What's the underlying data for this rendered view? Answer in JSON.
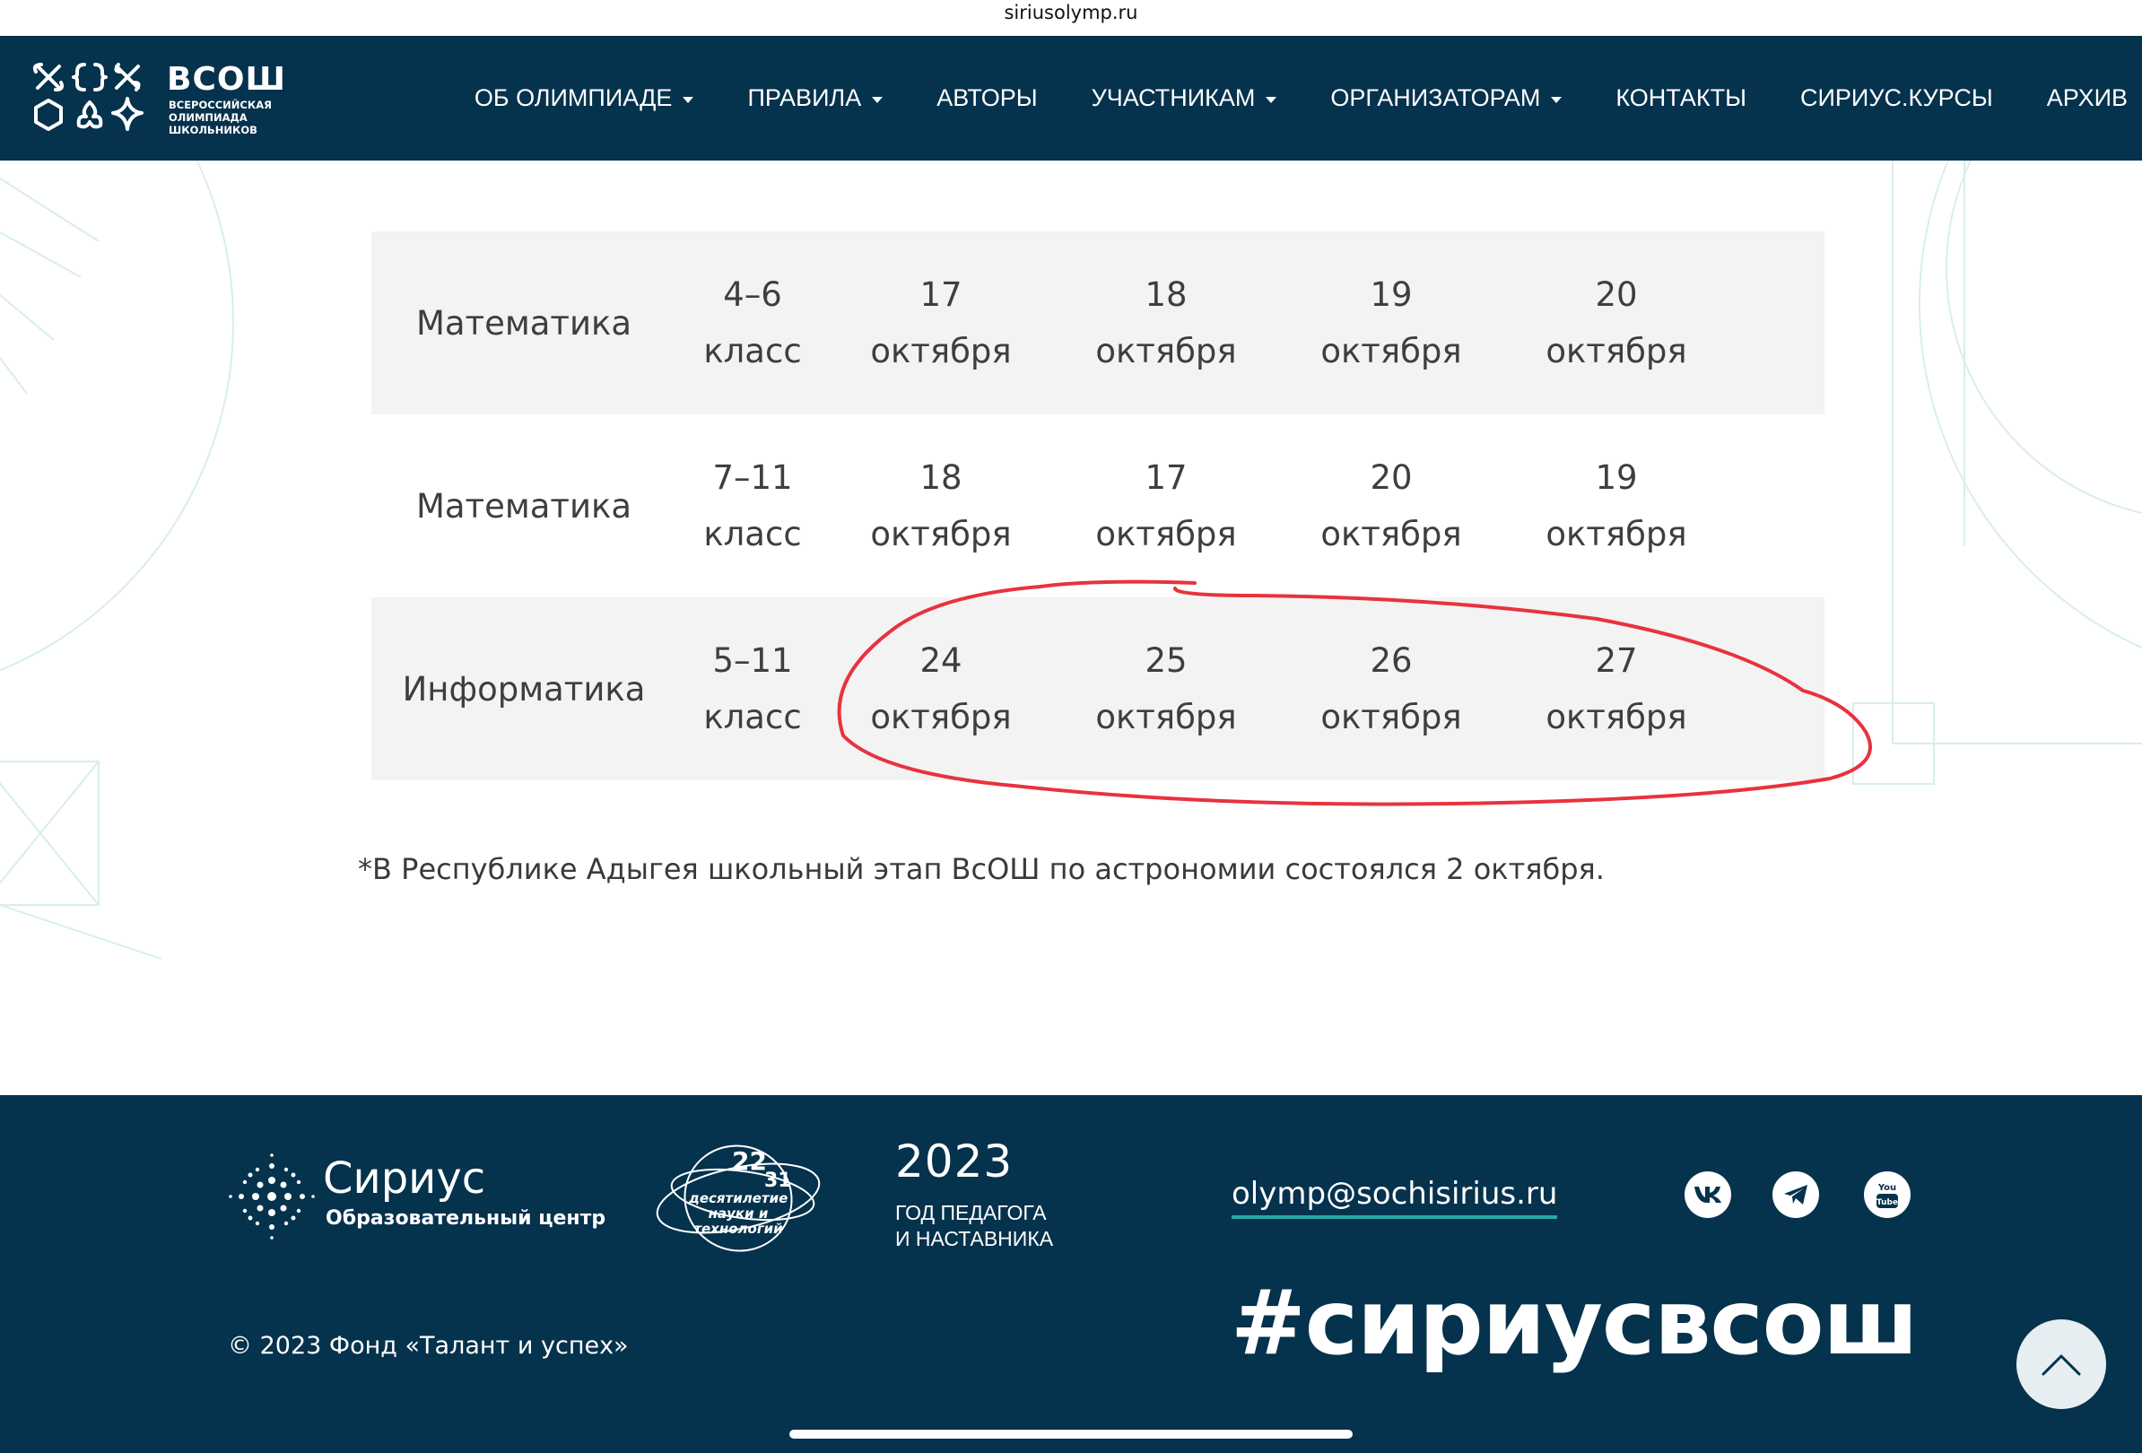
{
  "browser": {
    "url": "siriusolymp.ru"
  },
  "header": {
    "logo": {
      "title": "ВСОШ",
      "subtitle_lines": [
        "ВСЕРОССИЙСКАЯ",
        "ОЛИМПИАДА",
        "ШКОЛЬНИКОВ"
      ]
    },
    "nav": [
      {
        "label": "ОБ ОЛИМПИАДЕ",
        "dropdown": true
      },
      {
        "label": "ПРАВИЛА",
        "dropdown": true
      },
      {
        "label": "АВТОРЫ",
        "dropdown": false
      },
      {
        "label": "УЧАСТНИКАМ",
        "dropdown": true
      },
      {
        "label": "ОРГАНИЗАТОРАМ",
        "dropdown": true
      },
      {
        "label": "КОНТАКТЫ",
        "dropdown": false
      },
      {
        "label": "СИРИУС.КУРСЫ",
        "dropdown": false
      },
      {
        "label": "АРХИВ",
        "dropdown": false
      }
    ]
  },
  "table": {
    "partial_row": {
      "grade": "класс",
      "d1": "октября",
      "d2": "октября",
      "d3": "октября",
      "d4": "октября"
    },
    "rows": [
      {
        "subject": "Математика",
        "grade": [
          "4–6",
          "класс"
        ],
        "d1": [
          "17",
          "октября"
        ],
        "d2": [
          "18",
          "октября"
        ],
        "d3": [
          "19",
          "октября"
        ],
        "d4": [
          "20",
          "октября"
        ],
        "shaded": true
      },
      {
        "subject": "Математика",
        "grade": [
          "7–11",
          "класс"
        ],
        "d1": [
          "18",
          "октября"
        ],
        "d2": [
          "17",
          "октября"
        ],
        "d3": [
          "20",
          "октября"
        ],
        "d4": [
          "19",
          "октября"
        ],
        "shaded": false
      },
      {
        "subject": "Информатика",
        "grade": [
          "5–11",
          "класс"
        ],
        "d1": [
          "24",
          "октября"
        ],
        "d2": [
          "25",
          "октября"
        ],
        "d3": [
          "26",
          "октября"
        ],
        "d4": [
          "27",
          "октября"
        ],
        "shaded": true
      }
    ]
  },
  "note": "*В Республике Адыгея школьный этап ВсОШ по астрономии состоялся 2 октября.",
  "annotation": {
    "color": "#e8323f",
    "target": "Информатика dates"
  },
  "footer": {
    "sirius": {
      "name": "Сириус",
      "sub": "Образовательный центр"
    },
    "decade": {
      "num_a": "22",
      "num_b": "31",
      "text_lines": [
        "десятилетие",
        "науки и технологий"
      ]
    },
    "year": {
      "number": "2023",
      "lines": [
        "ГОД ПЕДАГОГА",
        "И НАСТАВНИКА"
      ]
    },
    "copyright": "© 2023 Фонд «Талант и успех»",
    "email": "olymp@sochisirius.ru",
    "social": [
      "vk-icon",
      "telegram-icon",
      "youtube-icon"
    ],
    "hashtag": "#сириусвсош"
  },
  "colors": {
    "header_bg": "#05324c",
    "row_shade": "#f3f3f3",
    "email_underline": "#27a8a4"
  }
}
